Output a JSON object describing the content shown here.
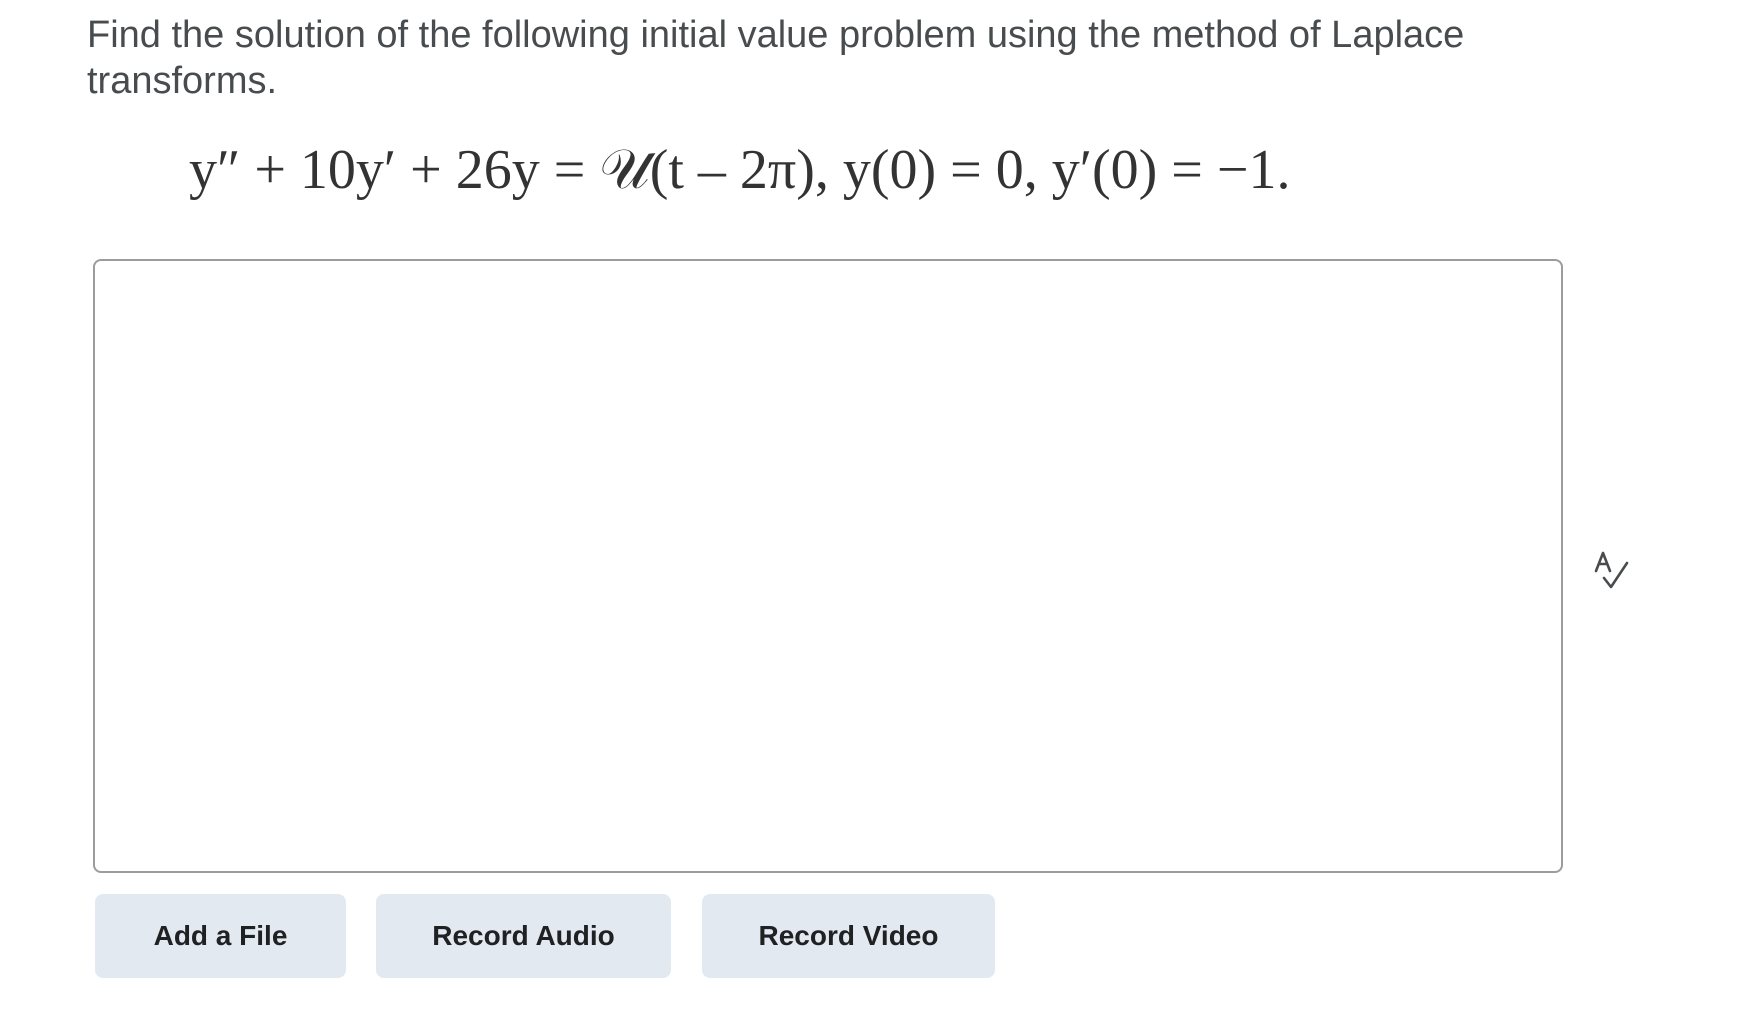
{
  "question": {
    "text": "Find the solution of the following initial value problem using the method of Laplace transforms."
  },
  "equation": {
    "text": "y″ + 10y′ + 26y = 𝒰(t – 2π),  y(0) = 0,  y′(0) = −1."
  },
  "answer": {
    "value": ""
  },
  "icons": {
    "spellcheck": "spellcheck-icon"
  },
  "buttons": {
    "add_file": "Add a File",
    "record_audio": "Record Audio",
    "record_video": "Record Video"
  },
  "colors": {
    "button_bg": "#e3e9f1",
    "text": "#494c4e",
    "border": "#9a9da0"
  }
}
